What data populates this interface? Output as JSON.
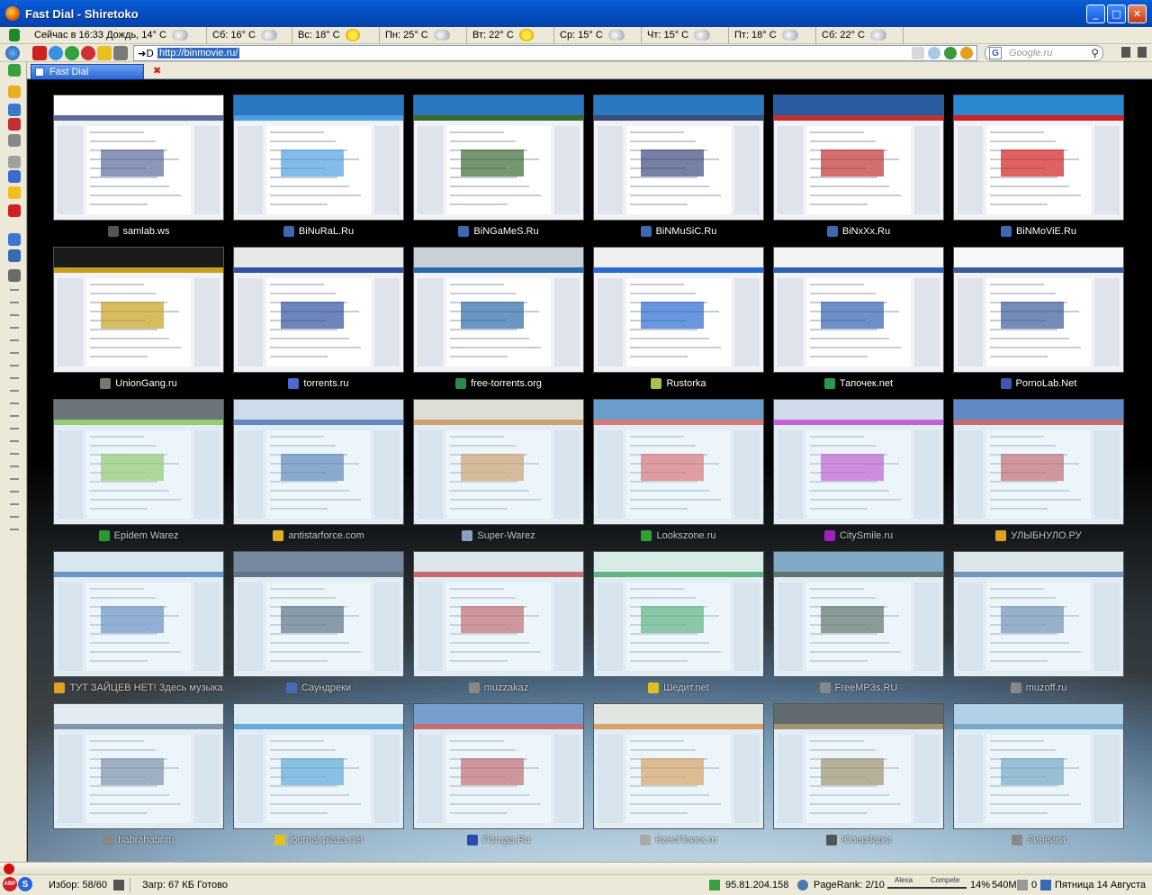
{
  "window": {
    "title": "Fast Dial - Shiretoko",
    "controls": {
      "minimize": "_",
      "maximize": "□",
      "close": "✕"
    }
  },
  "weather": {
    "current": "Сейчас в 16:33 Дождь, 14° C",
    "days": [
      {
        "label": "Сб: 16° C",
        "icon": "cloud-icon"
      },
      {
        "label": "Вс: 18° C",
        "icon": "sun-icon"
      },
      {
        "label": "Пн: 25° C",
        "icon": "cloud-icon"
      },
      {
        "label": "Вт: 22° C",
        "icon": "sun-icon"
      },
      {
        "label": "Ср: 15° C",
        "icon": "cloud-icon"
      },
      {
        "label": "Чт: 15° C",
        "icon": "cloud-icon"
      },
      {
        "label": "Пт: 18° C",
        "icon": "cloud-icon"
      },
      {
        "label": "Сб: 22° C",
        "icon": "cloud-icon"
      }
    ]
  },
  "navbar": {
    "url_value": "http://binmovie.ru/",
    "go_symbol": "➜D",
    "search_placeholder": "Google.ru",
    "search_engine_letter": "G"
  },
  "tabs": [
    {
      "label": "Fast Dial",
      "active": true
    }
  ],
  "dial": {
    "rows": [
      [
        {
          "label": "samlab.ws",
          "hdr": "#ffffff",
          "accent": "#5a6a9a",
          "fav": "#555555"
        },
        {
          "label": "BiNuRaL.Ru",
          "hdr": "#2a78c0",
          "accent": "#4ea0e0",
          "fav": "#3a6ab0"
        },
        {
          "label": "BiNGaMeS.Ru",
          "hdr": "#2a78c0",
          "accent": "#3a6a30",
          "fav": "#3a6ab0"
        },
        {
          "label": "BiNMuSiC.Ru",
          "hdr": "#2a78c0",
          "accent": "#3a4a7a",
          "fav": "#3a6ab0"
        },
        {
          "label": "BiNxXx.Ru",
          "hdr": "#2a5aa0",
          "accent": "#c03030",
          "fav": "#3a6ab0"
        },
        {
          "label": "BiNMoViE.Ru",
          "hdr": "#2a88d0",
          "accent": "#d02020",
          "fav": "#3a6ab0"
        }
      ],
      [
        {
          "label": "UnionGang.ru",
          "hdr": "#1a1a1a",
          "accent": "#c8a020",
          "fav": "#777777"
        },
        {
          "label": "torrents.ru",
          "hdr": "#e8e8e8",
          "accent": "#3050a0",
          "fav": "#4a6ad0"
        },
        {
          "label": "free-torrents.org",
          "hdr": "#c8d0d8",
          "accent": "#2a6aa8",
          "fav": "#2a8a4a"
        },
        {
          "label": "Rustorka",
          "hdr": "#f0f0f0",
          "accent": "#2a6ad0",
          "fav": "#a8c050"
        },
        {
          "label": "Тапочек.net",
          "hdr": "#f4f4f4",
          "accent": "#3060b0",
          "fav": "#2a9a4a"
        },
        {
          "label": "PornoLab.Net",
          "hdr": "#f8f8f8",
          "accent": "#3a5a9a",
          "fav": "#3a5ab0"
        }
      ],
      [
        {
          "label": "Epidem Warez",
          "hdr": "#3a3a3a",
          "accent": "#78c030",
          "fav": "#2a9a2a"
        },
        {
          "label": "antistarforce.com",
          "hdr": "#d0d8e8",
          "accent": "#2a5aa0",
          "fav": "#e0b020"
        },
        {
          "label": "Super-Warez",
          "hdr": "#e8dcc8",
          "accent": "#d08030",
          "fav": "#8aa0c0"
        },
        {
          "label": "Lookszone.ru",
          "hdr": "#3a78b8",
          "accent": "#e04040",
          "fav": "#30a030"
        },
        {
          "label": "CitySmile.ru",
          "hdr": "#d8d8e8",
          "accent": "#c020c0",
          "fav": "#a020c0"
        },
        {
          "label": "УЛЫБНУЛО.РУ",
          "hdr": "#2a5ab0",
          "accent": "#c03030",
          "fav": "#e0a020"
        }
      ],
      [
        {
          "label": "ТУТ ЗАЙЦЕВ НЕТ! Здесь музыка",
          "hdr": "#e0e8f0",
          "accent": "#3a6ab0",
          "fav": "#e0a020"
        },
        {
          "label": "Саундреки",
          "hdr": "#4a5870",
          "accent": "#2a3a50",
          "fav": "#4a6ab0"
        },
        {
          "label": "muzzakaz",
          "hdr": "#e8e8e8",
          "accent": "#c03030",
          "fav": "#888888"
        },
        {
          "label": "Шедит.net",
          "hdr": "#e0f0e0",
          "accent": "#2a9a4a",
          "fav": "#e0c020"
        },
        {
          "label": "FreeMP3s.RU",
          "hdr": "#5a8ab0",
          "accent": "#2a3a2a",
          "fav": "#888888"
        },
        {
          "label": "muzoff.ru",
          "hdr": "#e8e8e8",
          "accent": "#4a6a9a",
          "fav": "#888888"
        }
      ],
      [
        {
          "label": "habrahabr.ru",
          "hdr": "#f0f0f0",
          "accent": "#5a6a8a",
          "fav": "#888888"
        },
        {
          "label": "journal-plaza.net",
          "hdr": "#e8f0f8",
          "accent": "#2a8ad0",
          "fav": "#e0c020"
        },
        {
          "label": "Погода.Ru",
          "hdr": "#4a7ab8",
          "accent": "#c03030",
          "fav": "#2a4ab0"
        },
        {
          "label": "КиноПоиск.ru",
          "hdr": "#f0e8d8",
          "accent": "#e08020",
          "fav": "#aaaaaa"
        },
        {
          "label": "Юзербары",
          "hdr": "#2a2a2a",
          "accent": "#8a6a30",
          "fav": "#555555"
        },
        {
          "label": "Линейки",
          "hdr": "#a8c8e0",
          "accent": "#4a8ab0",
          "fav": "#888888"
        }
      ]
    ]
  },
  "statusbar": {
    "bookmarks": "Избор: 58/60",
    "status": "Загр: 67 КБ Готово",
    "ip": "95.81.204.158",
    "pagerank": "PageRank: 2/10",
    "alexa": "Alexa",
    "compete": "Compete",
    "cpu": "14%",
    "mem": "540M",
    "num": "0",
    "date": "Пятница 14 Августа",
    "abp": "ABP",
    "s_logo": "S"
  }
}
